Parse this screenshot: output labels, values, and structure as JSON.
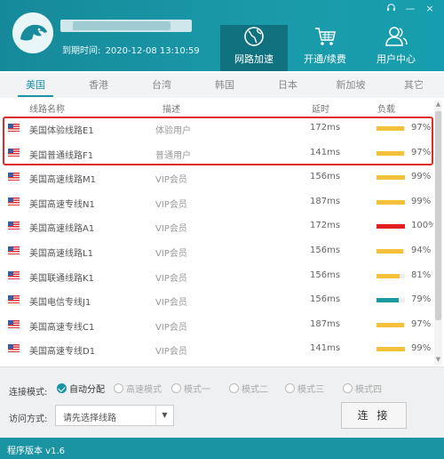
{
  "window_controls": {
    "support_icon": "headset-icon",
    "minimize": "—",
    "close": "×"
  },
  "header": {
    "expire_label": "到期时间:",
    "expire_value": "2020-12-08 13:10:59"
  },
  "nav": [
    {
      "label": "网路加速",
      "icon": "globe-icon",
      "active": true
    },
    {
      "label": "开通/续费",
      "icon": "cart-icon",
      "active": false
    },
    {
      "label": "用户中心",
      "icon": "user-icon",
      "active": false
    }
  ],
  "regions": [
    "美国",
    "香港",
    "台湾",
    "韩国",
    "日本",
    "新加坡",
    "其它"
  ],
  "active_region": "美国",
  "columns": {
    "name": "线路名称",
    "desc": "描述",
    "latency": "延时",
    "load": "负载"
  },
  "lines": [
    {
      "name": "美国体验线路E1",
      "desc": "体验用户",
      "latency": "172ms",
      "load": 97,
      "load_text": "97%",
      "color": "#f5c13a"
    },
    {
      "name": "美国普通线路F1",
      "desc": "普通用户",
      "latency": "141ms",
      "load": 97,
      "load_text": "97%",
      "color": "#f5c13a"
    },
    {
      "name": "美国高速线路M1",
      "desc": "VIP会员",
      "latency": "156ms",
      "load": 99,
      "load_text": "99%",
      "color": "#f5c13a"
    },
    {
      "name": "美国高速专线N1",
      "desc": "VIP会员",
      "latency": "187ms",
      "load": 99,
      "load_text": "99%",
      "color": "#f5c13a"
    },
    {
      "name": "美国高速线路A1",
      "desc": "VIP会员",
      "latency": "172ms",
      "load": 100,
      "load_text": "100%",
      "color": "#e02020"
    },
    {
      "name": "美国高速线路L1",
      "desc": "VIP会员",
      "latency": "156ms",
      "load": 94,
      "load_text": "94%",
      "color": "#f5c13a"
    },
    {
      "name": "美国联通线路K1",
      "desc": "VIP会员",
      "latency": "156ms",
      "load": 81,
      "load_text": "81%",
      "color": "#f5c13a"
    },
    {
      "name": "美国电信专线J1",
      "desc": "VIP会员",
      "latency": "156ms",
      "load": 79,
      "load_text": "79%",
      "color": "#1a9aa0"
    },
    {
      "name": "美国高速专线C1",
      "desc": "VIP会员",
      "latency": "187ms",
      "load": 97,
      "load_text": "97%",
      "color": "#f5c13a"
    },
    {
      "name": "美国高速专线D1",
      "desc": "VIP会员",
      "latency": "141ms",
      "load": 99,
      "load_text": "99%",
      "color": "#f5c13a"
    }
  ],
  "bottom": {
    "mode_label": "连接模式:",
    "modes": [
      {
        "label": "自动分配",
        "selected": true
      },
      {
        "label": "高速模式",
        "selected": false
      },
      {
        "label": "模式一",
        "selected": false
      },
      {
        "label": "模式二",
        "selected": false
      },
      {
        "label": "模式三",
        "selected": false
      },
      {
        "label": "模式四",
        "selected": false
      }
    ],
    "access_label": "访问方式:",
    "access_select_value": "请先选择线路",
    "connect_label": "连 接"
  },
  "status": {
    "version": "程序版本 v1.6"
  },
  "colors": {
    "accent": "#1a93a3",
    "header": "#1789a0",
    "highlight": "#e02a2a",
    "load_normal": "#f5c13a",
    "load_full": "#e02020"
  }
}
